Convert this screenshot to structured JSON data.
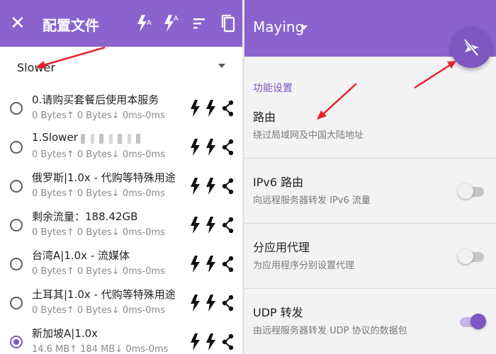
{
  "left": {
    "title": "配置文件",
    "close_icon": "close-icon",
    "toolbar_icons": [
      "test-connection-icon",
      "test-real-delay-icon",
      "sort-icon",
      "copy-icon"
    ],
    "profile": {
      "name": "Slower"
    },
    "servers": [
      {
        "name": "0.请购买套餐后使用本服务",
        "stats": "0 Bytes↑ 0 Bytes↓ 0ms-0ms",
        "selected": false
      },
      {
        "name": "1.Slower - ",
        "stats": "0 Bytes↑ 0 Bytes↓ 0ms-0ms",
        "selected": false
      },
      {
        "name": "俄罗斯|1.0x - 代购等特殊用途",
        "stats": "0 Bytes↑ 0 Bytes↓ 0ms-0ms",
        "selected": false
      },
      {
        "name": "剩余流量：188.42GB",
        "stats": "0 Bytes↑ 0 Bytes↓ 0ms-0ms",
        "selected": false
      },
      {
        "name": "台湾A|1.0x - 流媒体",
        "stats": "0 Bytes↑ 0 Bytes↓ 0ms-0ms",
        "selected": false
      },
      {
        "name": "土耳其|1.0x - 代购等特殊用途",
        "stats": "0 Bytes↑ 0 Bytes↓ 0ms-0ms",
        "selected": false
      },
      {
        "name": "新加坡A|1.0x",
        "stats": "14.6 MB↑ 184 MB↓ 0ms-0ms",
        "selected": true
      }
    ]
  },
  "right": {
    "title": "Maying",
    "fab_icon": "vpn-off-icon",
    "section": "功能设置",
    "settings": [
      {
        "title": "路由",
        "subtitle": "绕过局域网及中国大陆地址",
        "has_switch": false
      },
      {
        "title": "IPv6 路由",
        "subtitle": "向远程服务器转发 IPv6 流量",
        "has_switch": true,
        "on": false
      },
      {
        "title": "分应用代理",
        "subtitle": "为应用程序分别设置代理",
        "has_switch": true,
        "on": false
      },
      {
        "title": "UDP 转发",
        "subtitle": "由远程服务器转发 UDP 协议的数据包",
        "has_switch": true,
        "on": true
      }
    ]
  },
  "colors": {
    "accent": "#7e57c2",
    "toolbar": "#8a63cf",
    "arrow": "#e8212b"
  }
}
